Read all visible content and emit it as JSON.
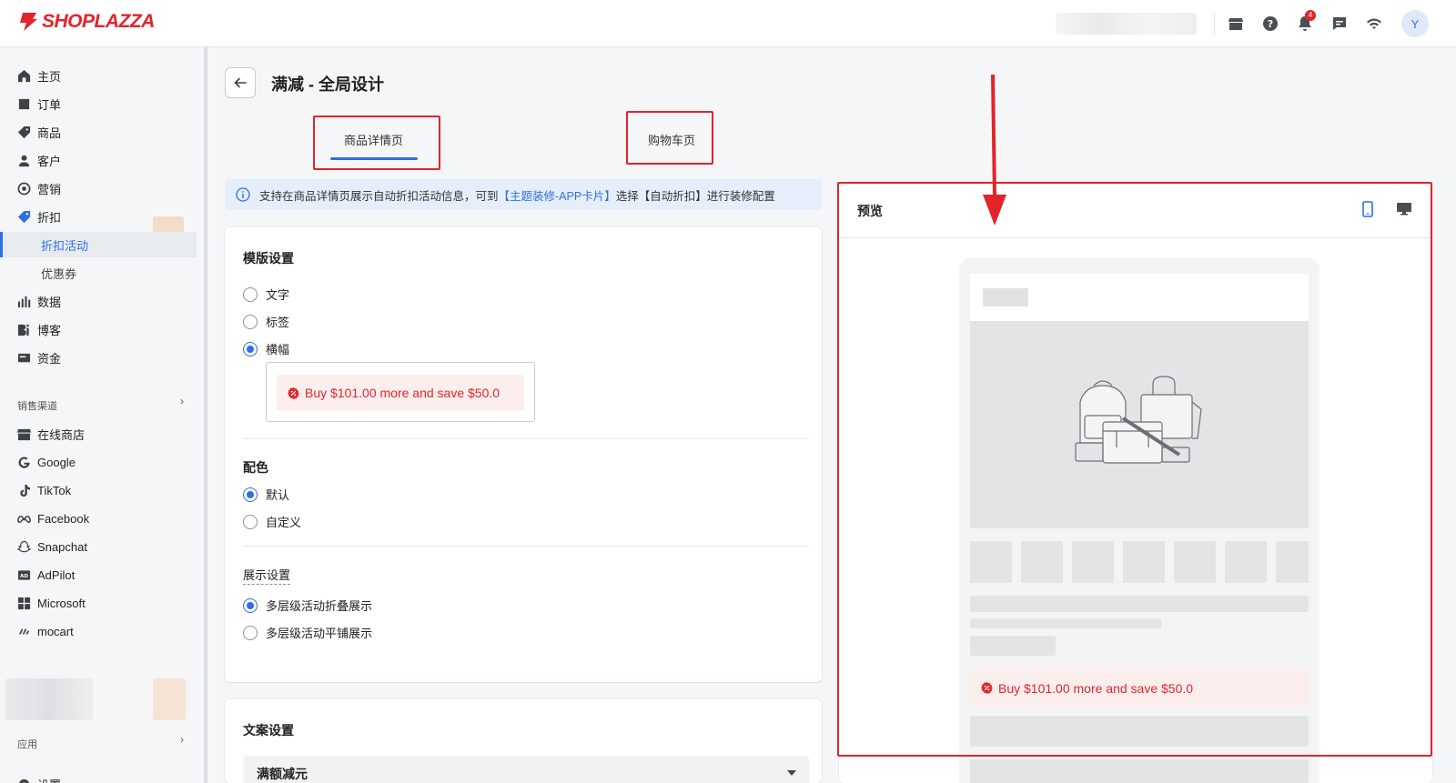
{
  "brand": {
    "name": "SHOPLAZZA",
    "color": "#e3242b"
  },
  "accent": "#2f6fe4",
  "topbar": {
    "notification_count": "4",
    "avatar_initial": "Y",
    "icons": [
      "store-icon",
      "help-icon",
      "bell-icon",
      "chat-icon",
      "wifi-icon"
    ]
  },
  "sidebar": {
    "items": [
      {
        "label": "主页",
        "icon": "home-icon"
      },
      {
        "label": "订单",
        "icon": "orders-icon"
      },
      {
        "label": "商品",
        "icon": "tag-icon"
      },
      {
        "label": "客户",
        "icon": "user-icon"
      },
      {
        "label": "营销",
        "icon": "marketing-icon"
      },
      {
        "label": "折扣",
        "icon": "discount-icon"
      },
      {
        "label": "折扣活动",
        "active": true
      },
      {
        "label": "优惠券"
      },
      {
        "label": "数据",
        "icon": "chart-icon"
      },
      {
        "label": "博客",
        "icon": "blog-icon"
      },
      {
        "label": "资金",
        "icon": "wallet-icon"
      }
    ],
    "sales_channels_label": "销售渠道",
    "channels": [
      {
        "label": "在线商店",
        "icon": "store-icon"
      },
      {
        "label": "Google",
        "icon": "google-icon"
      },
      {
        "label": "TikTok",
        "icon": "tiktok-icon"
      },
      {
        "label": "Facebook",
        "icon": "meta-icon"
      },
      {
        "label": "Snapchat",
        "icon": "snapchat-icon"
      },
      {
        "label": "AdPilot",
        "icon": "adpilot-icon"
      },
      {
        "label": "Microsoft",
        "icon": "microsoft-icon"
      },
      {
        "label": "mocart",
        "icon": "mocart-icon"
      }
    ],
    "apps_label": "应用",
    "settings_label": "设置"
  },
  "page": {
    "title": "满减 - 全局设计",
    "tabs": [
      {
        "label": "商品详情页",
        "active": true
      },
      {
        "label": "购物车页",
        "active": false
      }
    ],
    "info": {
      "before": "支持在商品详情页展示自动折扣活动信息，可到",
      "link": "【主题装修-APP卡片】",
      "after": "选择【自动折扣】进行装修配置"
    }
  },
  "template_settings": {
    "title": "模版设置",
    "options": [
      {
        "label": "文字",
        "checked": false
      },
      {
        "label": "标签",
        "checked": false
      },
      {
        "label": "横幅",
        "checked": true
      }
    ],
    "banner_text": "Buy $101.00 more and save $50.0"
  },
  "color_settings": {
    "title": "配色",
    "options": [
      {
        "label": "默认",
        "checked": true
      },
      {
        "label": "自定义",
        "checked": false
      }
    ]
  },
  "display_settings": {
    "title": "展示设置",
    "options": [
      {
        "label": "多层级活动折叠展示",
        "checked": true
      },
      {
        "label": "多层级活动平铺展示",
        "checked": false
      }
    ]
  },
  "copy_settings": {
    "title": "文案设置",
    "select_value": "满额减元"
  },
  "preview": {
    "title": "预览",
    "promo_text": "Buy $101.00 more and save $50.0"
  }
}
